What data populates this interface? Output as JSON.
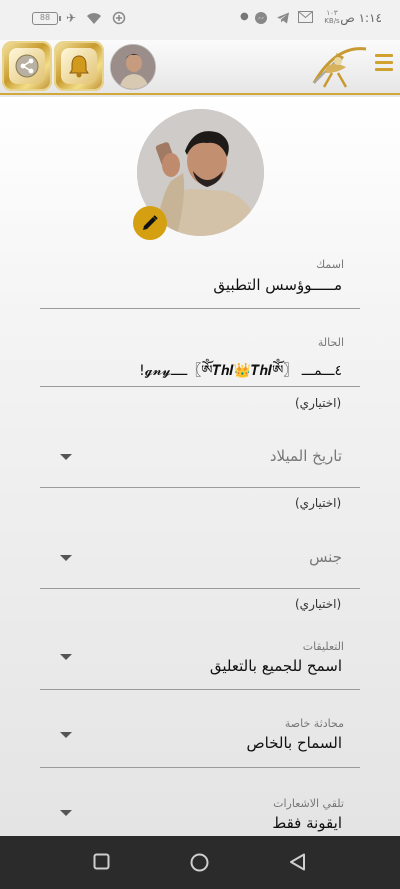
{
  "status_bar": {
    "time": "١:١٤ ص",
    "netspeed_value": "١٠٣",
    "netspeed_unit": "KB/s",
    "battery": "88"
  },
  "header": {
    "icons": [
      "share-icon",
      "bell-icon",
      "app-logo-archer",
      "menu-icon"
    ]
  },
  "profile": {
    "name_label": "اسمك",
    "name_value": "مـــــوؤسس التطبيق",
    "status_label": "الحالة",
    "status_value": "٤ـــمـــ 〖ༀ𝑻𝒉𝑰👑𝑻𝒉𝑰ༀ〗ــــ𝓰𝓷𝔂!",
    "optional_1": "(اختياري)",
    "birthdate_placeholder": "تاريخ الميلاد",
    "optional_2": "(اختياري)",
    "gender_placeholder": "جنس",
    "optional_3": "(اختياري)",
    "comments_label": "التعليقات",
    "comments_value": "اسمح للجميع بالتعليق",
    "private_chat_label": "محادثة خاصة",
    "private_chat_value": "السماح بالخاص",
    "notifications_label": "تلقي الاشعارات",
    "notifications_value": "ايقونة فقط"
  },
  "colors": {
    "accent_gold": "#d4a012",
    "nav_bar": "#2b2b2b"
  }
}
